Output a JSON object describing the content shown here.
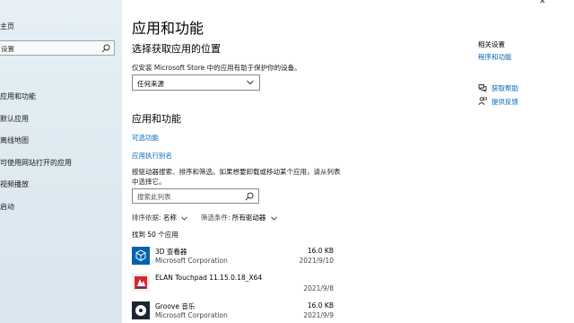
{
  "sidebar": {
    "home_label": "主页",
    "search_placeholder": "设置",
    "items": [
      {
        "label": "应用和功能"
      },
      {
        "label": "默认应用"
      },
      {
        "label": "离线地图"
      },
      {
        "label": "可使用网站打开的应用"
      },
      {
        "label": "视频播放"
      },
      {
        "label": "启动"
      }
    ]
  },
  "main": {
    "title": "应用和功能",
    "source_section": {
      "heading": "选择获取应用的位置",
      "description": "仅安装 Microsoft Store 中的应用有助于保护你的设备。",
      "dropdown_value": "任何来源"
    },
    "apps_section": {
      "heading": "应用和功能",
      "optional_features_link": "可选功能",
      "app_alias_link": "应用执行别名",
      "description": "按驱动器搜索、排序和筛选。如果想要卸载或移动某个应用，请从列表中选择它。",
      "search_placeholder": "搜索此列表",
      "sort_label": "排序依据:",
      "sort_value": "名称",
      "filter_label": "筛选条件:",
      "filter_value": "所有驱动器",
      "found_text": "找到 50 个应用",
      "apps": [
        {
          "name": "3D 查看器",
          "publisher": "Microsoft Corporation",
          "size": "16.0 KB",
          "date": "2021/9/10",
          "icon": "cube-icon"
        },
        {
          "name": "ELAN Touchpad 11.15.0.18_X64",
          "publisher": "",
          "size": "",
          "date": "2021/9/8",
          "icon": "touchpad-app-icon"
        },
        {
          "name": "Groove 音乐",
          "publisher": "Microsoft Corporation",
          "size": "16.0 KB",
          "date": "2021/9/9",
          "icon": "music-disc-icon"
        }
      ]
    }
  },
  "related": {
    "title": "相关设置",
    "programs_link": "程序和功能",
    "get_help": "获取帮助",
    "feedback": "提供反馈"
  },
  "window": {
    "close_glyph": "✕"
  },
  "colors": {
    "accent": "#0067b8",
    "app_tile": "#0063b1"
  }
}
